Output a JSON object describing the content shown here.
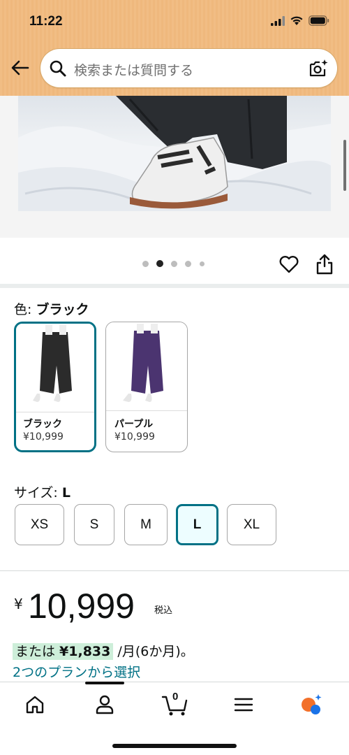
{
  "status_bar": {
    "time": "11:22"
  },
  "search": {
    "placeholder": "検索または質問する"
  },
  "carousel": {
    "total": 5,
    "active_index": 1
  },
  "color": {
    "label": "色: ",
    "selected": "ブラック",
    "options": [
      {
        "name": "ブラック",
        "price": "¥10,999",
        "color": "#2b2b2b"
      },
      {
        "name": "パープル",
        "price": "¥10,999",
        "color": "#4b3470"
      }
    ]
  },
  "size": {
    "label": "サイズ: ",
    "selected": "L",
    "options": [
      "XS",
      "S",
      "M",
      "L",
      "XL"
    ]
  },
  "price": {
    "symbol": "¥",
    "value": "10,999",
    "tax": "税込"
  },
  "installment": {
    "prefix": "または ",
    "amount": "¥1,833",
    "suffix": " /月(6か月)。",
    "link": "2つのプランから選択"
  },
  "nav": {
    "cart_count": "0"
  },
  "colors": {
    "accent": "#007185",
    "header": "#f1bd84"
  }
}
